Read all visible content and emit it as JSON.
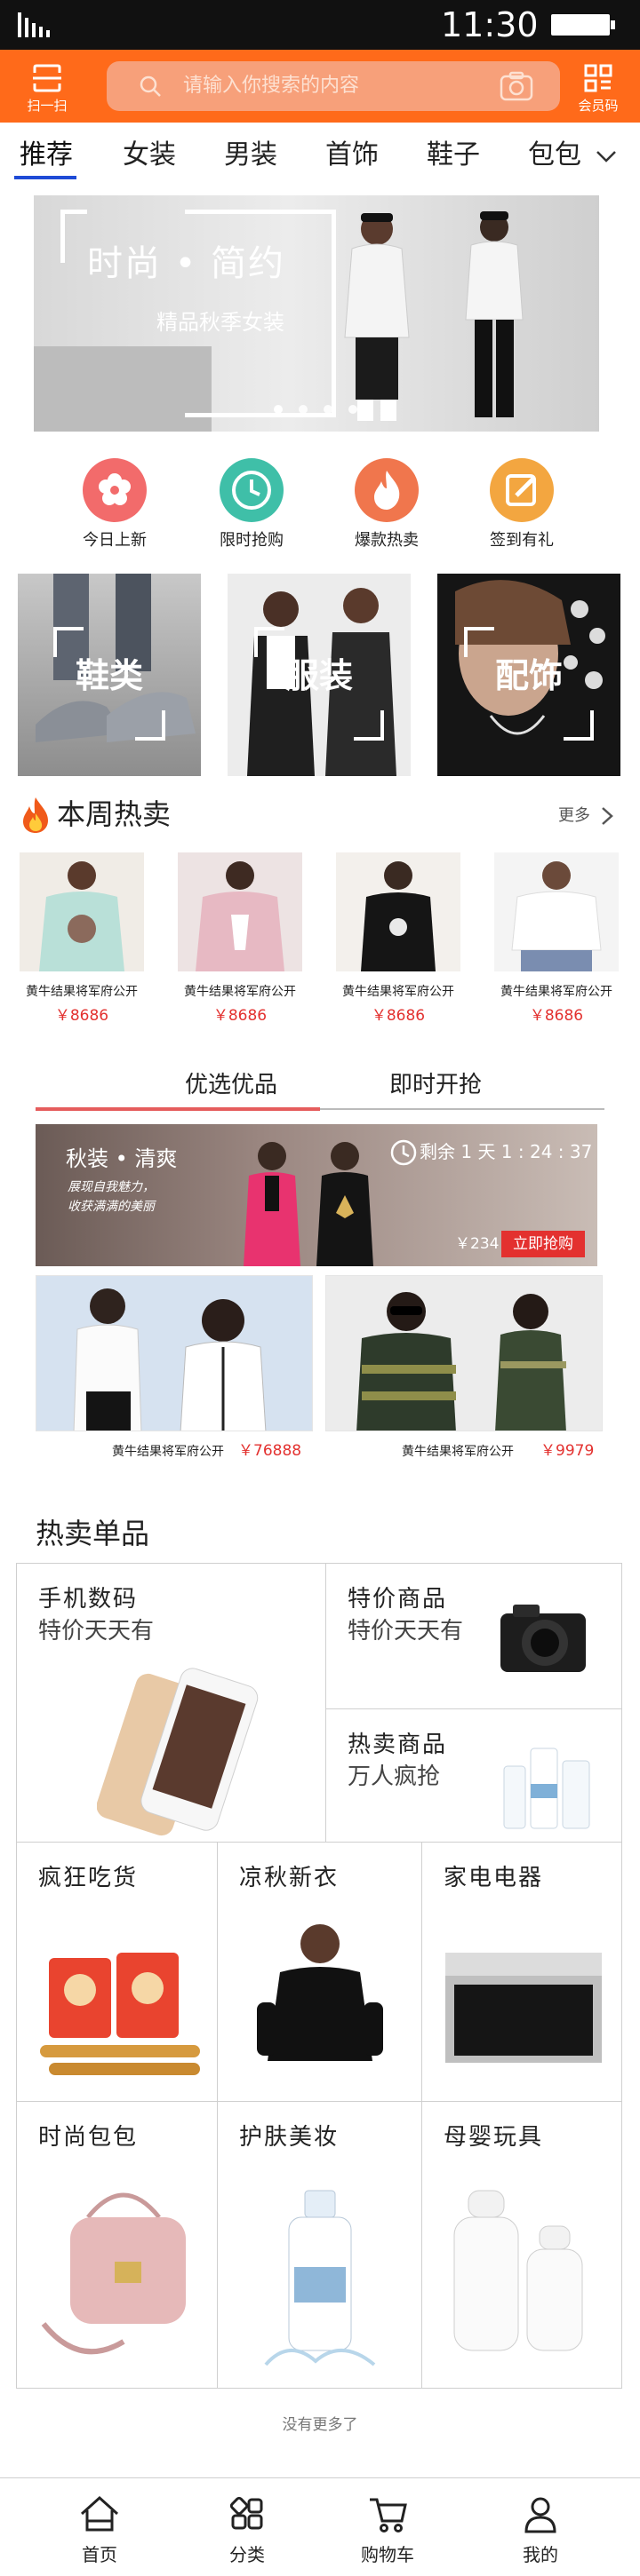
{
  "status_bar": {
    "time": "11:30"
  },
  "header": {
    "scan_label": "扫一扫",
    "search_placeholder": "请输入你搜索的内容",
    "member_label": "会员码",
    "brand_color": "#ff6a1a"
  },
  "tabs": [
    {
      "label": "推荐",
      "active": true
    },
    {
      "label": "女装",
      "active": false
    },
    {
      "label": "男装",
      "active": false
    },
    {
      "label": "首饰",
      "active": false
    },
    {
      "label": "鞋子",
      "active": false
    },
    {
      "label": "包包",
      "active": false
    }
  ],
  "banner": {
    "title": "时尚 • 简约",
    "subtitle": "精品秋季女装",
    "slide_count": 4,
    "active_slide": 1
  },
  "shortcuts": [
    {
      "label": "今日上新",
      "icon": "flower-icon",
      "color": "#f26b6b"
    },
    {
      "label": "限时抢购",
      "icon": "clock-icon",
      "color": "#3fbfa8"
    },
    {
      "label": "爆款热卖",
      "icon": "flame-icon",
      "color": "#f0764d"
    },
    {
      "label": "签到有礼",
      "icon": "edit-icon",
      "color": "#f3a640"
    }
  ],
  "categories": [
    {
      "label": "鞋类"
    },
    {
      "label": "服装"
    },
    {
      "label": "配饰"
    }
  ],
  "hot_week": {
    "title": "本周热卖",
    "more": "更多",
    "products": [
      {
        "name": "黄牛结果将军府公开",
        "price": "￥8686"
      },
      {
        "name": "黄牛结果将军府公开",
        "price": "￥8686"
      },
      {
        "name": "黄牛结果将军府公开",
        "price": "￥8686"
      },
      {
        "name": "黄牛结果将军府公开",
        "price": "￥8686"
      }
    ]
  },
  "picks": {
    "tabs": [
      {
        "label": "优选优品",
        "active": true
      },
      {
        "label": "即时开抢",
        "active": false
      }
    ],
    "promo": {
      "tag": "秋装 • 清爽",
      "slogan1": "展现自我魅力，",
      "slogan2": "收获满满的美丽",
      "countdown": "剩余 1 天 1 : 24 : 37",
      "price": "￥234",
      "buy_label": "立即抢购"
    },
    "items": [
      {
        "name": "黄牛结果将军府公开",
        "price": "￥76888"
      },
      {
        "name": "黄牛结果将军府公开",
        "price": "￥9979"
      }
    ]
  },
  "singles": {
    "title": "热卖单品",
    "cells": [
      {
        "title": "手机数码",
        "subtitle": "特价天天有"
      },
      {
        "title": "特价商品",
        "subtitle": "特价天天有"
      },
      {
        "title": "热卖商品",
        "subtitle": "万人疯抢"
      },
      {
        "title": "疯狂吃货",
        "subtitle": ""
      },
      {
        "title": "凉秋新衣",
        "subtitle": ""
      },
      {
        "title": "家电电器",
        "subtitle": ""
      },
      {
        "title": "时尚包包",
        "subtitle": ""
      },
      {
        "title": "护肤美妆",
        "subtitle": ""
      },
      {
        "title": "母婴玩具",
        "subtitle": ""
      }
    ]
  },
  "footer_note": "没有更多了",
  "bottom_nav": [
    {
      "label": "首页",
      "icon": "home-icon"
    },
    {
      "label": "分类",
      "icon": "category-icon"
    },
    {
      "label": "购物车",
      "icon": "cart-icon"
    },
    {
      "label": "我的",
      "icon": "user-icon"
    }
  ]
}
